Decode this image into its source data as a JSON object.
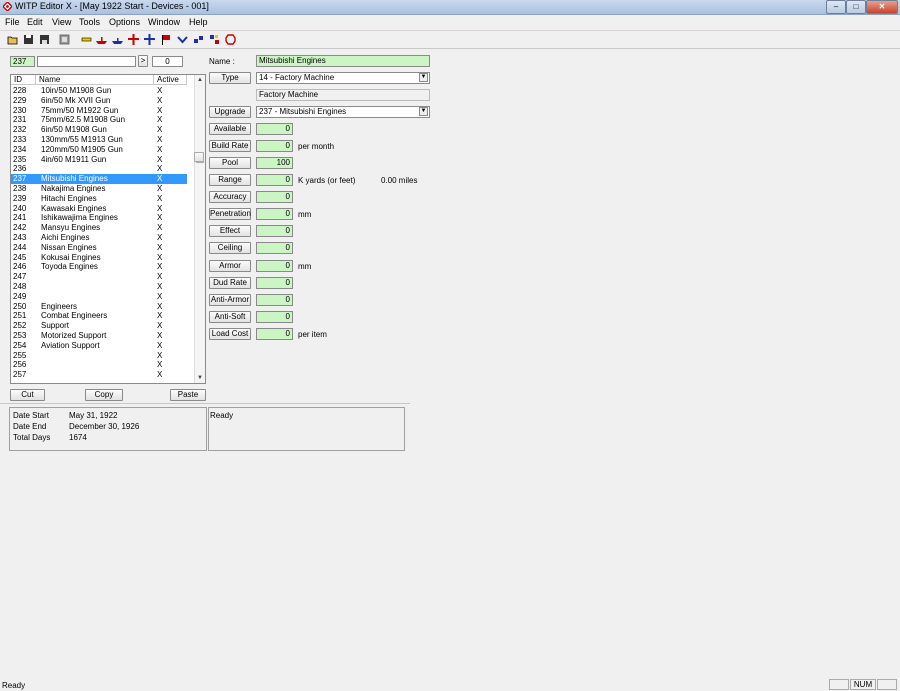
{
  "window": {
    "title": "WITP Editor X - [May 1922 Start - Devices - 001]",
    "controls": {
      "minimize": "–",
      "maximize": "□",
      "close": "✕"
    }
  },
  "menu": [
    "File",
    "Edit",
    "View",
    "Tools",
    "Options",
    "Window",
    "Help"
  ],
  "toolbar": {
    "icons": [
      "open-icon",
      "save-icon",
      "save-all-icon",
      "document-icon",
      "device-icon",
      "ship-icon",
      "ship-class-icon",
      "aircraft-icon",
      "aircraft-group-icon",
      "flag-icon",
      "chevron-icon",
      "unit-icon",
      "map-icon",
      "leader-icon"
    ],
    "colors": {
      "accent_red": "#cc0000",
      "accent_blue": "#1a2fa8"
    }
  },
  "search": {
    "id_value": "237",
    "text_value": "",
    "go_label": ">",
    "count_value": "0"
  },
  "list": {
    "headers": {
      "id": "ID",
      "name": "Name",
      "active": "Active"
    },
    "selected_id": "237",
    "rows": [
      {
        "id": "228",
        "name": "10in/50 M1908 Gun",
        "active": "X"
      },
      {
        "id": "229",
        "name": "6in/50 Mk XVII Gun",
        "active": "X"
      },
      {
        "id": "230",
        "name": "75mm/50 M1922 Gun",
        "active": "X"
      },
      {
        "id": "231",
        "name": "75mm/62.5 M1908 Gun",
        "active": "X"
      },
      {
        "id": "232",
        "name": "6in/50 M1908 Gun",
        "active": "X"
      },
      {
        "id": "233",
        "name": "130mm/55 M1913 Gun",
        "active": "X"
      },
      {
        "id": "234",
        "name": "120mm/50 M1905 Gun",
        "active": "X"
      },
      {
        "id": "235",
        "name": "4in/60 M1911 Gun",
        "active": "X"
      },
      {
        "id": "236",
        "name": "",
        "active": "X"
      },
      {
        "id": "237",
        "name": "Mitsubishi Engines",
        "active": "X"
      },
      {
        "id": "238",
        "name": "Nakajima Engines",
        "active": "X"
      },
      {
        "id": "239",
        "name": "Hitachi Engines",
        "active": "X"
      },
      {
        "id": "240",
        "name": "Kawasaki Engines",
        "active": "X"
      },
      {
        "id": "241",
        "name": "Ishikawajima Engines",
        "active": "X"
      },
      {
        "id": "242",
        "name": "Mansyu Engines",
        "active": "X"
      },
      {
        "id": "243",
        "name": "Aichi Engines",
        "active": "X"
      },
      {
        "id": "244",
        "name": "Nissan Engines",
        "active": "X"
      },
      {
        "id": "245",
        "name": "Kokusai Engines",
        "active": "X"
      },
      {
        "id": "246",
        "name": "Toyoda Engines",
        "active": "X"
      },
      {
        "id": "247",
        "name": "",
        "active": "X"
      },
      {
        "id": "248",
        "name": "",
        "active": "X"
      },
      {
        "id": "249",
        "name": "",
        "active": "X"
      },
      {
        "id": "250",
        "name": "Engineers",
        "active": "X"
      },
      {
        "id": "251",
        "name": "Combat Engineers",
        "active": "X"
      },
      {
        "id": "252",
        "name": "Support",
        "active": "X"
      },
      {
        "id": "253",
        "name": "Motorized Support",
        "active": "X"
      },
      {
        "id": "254",
        "name": "Aviation Support",
        "active": "X"
      },
      {
        "id": "255",
        "name": "",
        "active": "X"
      },
      {
        "id": "256",
        "name": "",
        "active": "X"
      },
      {
        "id": "257",
        "name": "",
        "active": "X"
      }
    ]
  },
  "clipboard": {
    "cut": "Cut",
    "copy": "Copy",
    "paste": "Paste"
  },
  "form": {
    "name_label": "Name :",
    "name_value": "Mitsubishi Engines",
    "type_label": "Type",
    "type_value": "14 - Factory Machine",
    "type_desc": "Factory Machine",
    "upgrade_label": "Upgrade",
    "upgrade_value": "237 - Mitsubishi Engines",
    "fields": [
      {
        "label": "Available",
        "value": "0",
        "unit": ""
      },
      {
        "label": "Build Rate",
        "value": "0",
        "unit": "per month"
      },
      {
        "label": "Pool",
        "value": "100",
        "unit": ""
      },
      {
        "label": "Range",
        "value": "0",
        "unit": "K yards (or feet)",
        "extra": "0.00 miles"
      },
      {
        "label": "Accuracy",
        "value": "0",
        "unit": ""
      },
      {
        "label": "Penetration",
        "value": "0",
        "unit": "mm"
      },
      {
        "label": "Effect",
        "value": "0",
        "unit": ""
      },
      {
        "label": "Ceiling",
        "value": "0",
        "unit": ""
      },
      {
        "label": "Armor",
        "value": "0",
        "unit": "mm"
      },
      {
        "label": "Dud Rate",
        "value": "0",
        "unit": ""
      },
      {
        "label": "Anti-Armor",
        "value": "0",
        "unit": ""
      },
      {
        "label": "Anti-Soft",
        "value": "0",
        "unit": ""
      },
      {
        "label": "Load Cost",
        "value": "0",
        "unit": "per item"
      }
    ],
    "field_color": "#ccf5c4"
  },
  "dates": {
    "start_label": "Date Start",
    "start_value": "May 31, 1922",
    "end_label": "Date End",
    "end_value": "December 30, 1926",
    "total_label": "Total Days",
    "total_value": "1674"
  },
  "log": {
    "text": "Ready"
  },
  "status": {
    "text": "Ready",
    "num": "NUM"
  }
}
